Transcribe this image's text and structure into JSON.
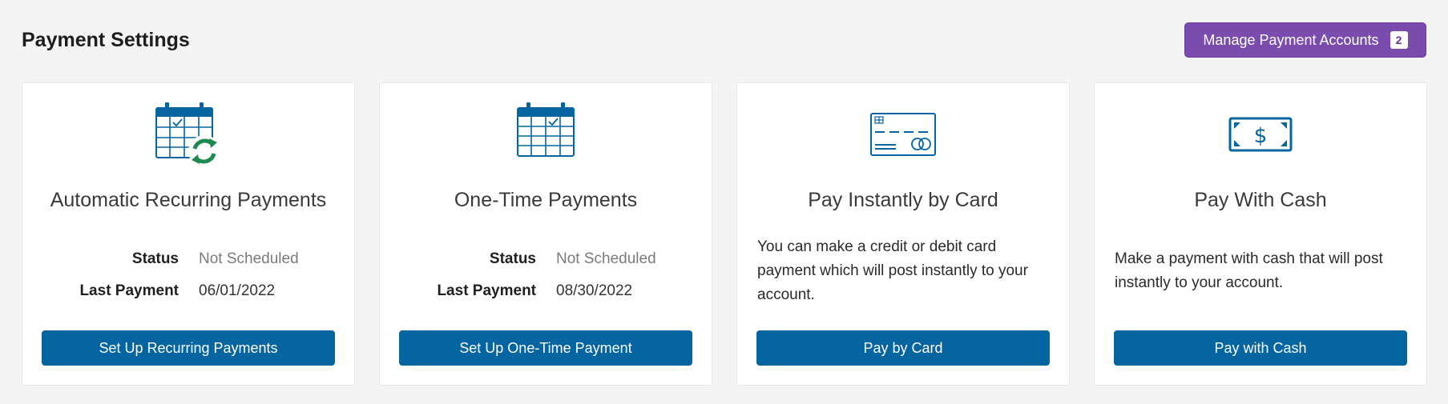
{
  "header": {
    "title": "Payment Settings",
    "manage_button": {
      "label": "Manage Payment Accounts",
      "badge_count": "2"
    }
  },
  "colors": {
    "primary": "#0565a1",
    "accent_purple": "#7a4cad",
    "refresh_green": "#1e8a4f"
  },
  "cards": [
    {
      "icon": "calendar-recurring-icon",
      "title": "Automatic Recurring Payments",
      "status_label": "Status",
      "status_value": "Not Scheduled",
      "last_payment_label": "Last Payment",
      "last_payment_value": "06/01/2022",
      "button_label": "Set Up Recurring Payments"
    },
    {
      "icon": "calendar-icon",
      "title": "One-Time Payments",
      "status_label": "Status",
      "status_value": "Not Scheduled",
      "last_payment_label": "Last Payment",
      "last_payment_value": "08/30/2022",
      "button_label": "Set Up One-Time Payment"
    },
    {
      "icon": "credit-card-icon",
      "title": "Pay Instantly by Card",
      "description": "You can make a credit or debit card payment which will post instantly to your account.",
      "button_label": "Pay by Card"
    },
    {
      "icon": "cash-icon",
      "title": "Pay With Cash",
      "description": "Make a payment with cash that will post instantly to your account.",
      "button_label": "Pay with Cash"
    }
  ]
}
